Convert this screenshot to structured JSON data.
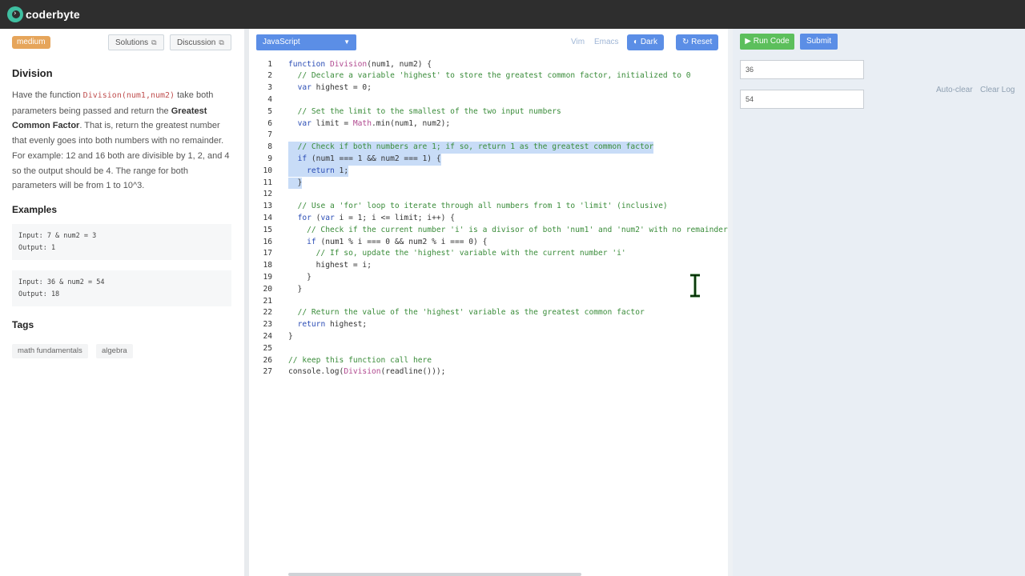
{
  "app": {
    "logo_text": "coderbyte"
  },
  "left_panel": {
    "difficulty": "medium",
    "solutions_label": "Solutions",
    "discussion_label": "Discussion",
    "title": "Division",
    "desc": {
      "p1": "Have the function ",
      "code": "Division(num1,num2)",
      "p2": " take both parameters being passed and return the ",
      "bold": "Greatest Common Factor",
      "p3": ". That is, return the greatest number that evenly goes into both numbers with no remainder. For example: 12 and 16 both are divisible by 1, 2, and 4 so the output should be 4. The range for both parameters will be from 1 to 10^3."
    },
    "examples_heading": "Examples",
    "examples": [
      {
        "input": "Input: 7 & num2 = 3",
        "output": "Output: 1"
      },
      {
        "input": "Input: 36 & num2 = 54",
        "output": "Output: 18"
      }
    ],
    "tags_heading": "Tags",
    "tags": [
      "math fundamentals",
      "algebra"
    ]
  },
  "editor": {
    "language": "JavaScript",
    "vim_label": "Vim",
    "emacs_label": "Emacs",
    "dark_label": "Dark",
    "reset_label": "Reset",
    "lines": [
      {
        "n": "1",
        "t": "function Division(num1, num2) {"
      },
      {
        "n": "2",
        "t": "  // Declare a variable 'highest' to store the greatest common factor, initialized to 0"
      },
      {
        "n": "3",
        "t": "  var highest = 0;"
      },
      {
        "n": "4",
        "t": ""
      },
      {
        "n": "5",
        "t": "  // Set the limit to the smallest of the two input numbers"
      },
      {
        "n": "6",
        "t": "  var limit = Math.min(num1, num2);"
      },
      {
        "n": "7",
        "t": ""
      },
      {
        "n": "8",
        "t": "  // Check if both numbers are 1; if so, return 1 as the greatest common factor"
      },
      {
        "n": "9",
        "t": "  if (num1 === 1 && num2 === 1) {"
      },
      {
        "n": "10",
        "t": "    return 1;"
      },
      {
        "n": "11",
        "t": "  }"
      },
      {
        "n": "12",
        "t": ""
      },
      {
        "n": "13",
        "t": "  // Use a 'for' loop to iterate through all numbers from 1 to 'limit' (inclusive)"
      },
      {
        "n": "14",
        "t": "  for (var i = 1; i <= limit; i++) {"
      },
      {
        "n": "15",
        "t": "    // Check if the current number 'i' is a divisor of both 'num1' and 'num2' with no remainder"
      },
      {
        "n": "16",
        "t": "    if (num1 % i === 0 && num2 % i === 0) {"
      },
      {
        "n": "17",
        "t": "      // If so, update the 'highest' variable with the current number 'i'"
      },
      {
        "n": "18",
        "t": "      highest = i;"
      },
      {
        "n": "19",
        "t": "    }"
      },
      {
        "n": "20",
        "t": "  }"
      },
      {
        "n": "21",
        "t": ""
      },
      {
        "n": "22",
        "t": "  // Return the value of the 'highest' variable as the greatest common factor"
      },
      {
        "n": "23",
        "t": "  return highest;"
      },
      {
        "n": "24",
        "t": "}"
      },
      {
        "n": "25",
        "t": ""
      },
      {
        "n": "26",
        "t": "// keep this function call here"
      },
      {
        "n": "27",
        "t": "console.log(Division(readline()));"
      }
    ],
    "selected_lines": [
      "8",
      "9",
      "10",
      "11"
    ]
  },
  "right_panel": {
    "run_label": "Run Code",
    "submit_label": "Submit",
    "input1": "36",
    "input2": "54",
    "auto_clear_label": "Auto-clear",
    "clear_log_label": "Clear Log"
  },
  "colors": {
    "accent_blue": "#5b8ee6",
    "run_green": "#5cbf5c",
    "badge_orange": "#e6a55b",
    "selection": "#c8dcf7"
  }
}
